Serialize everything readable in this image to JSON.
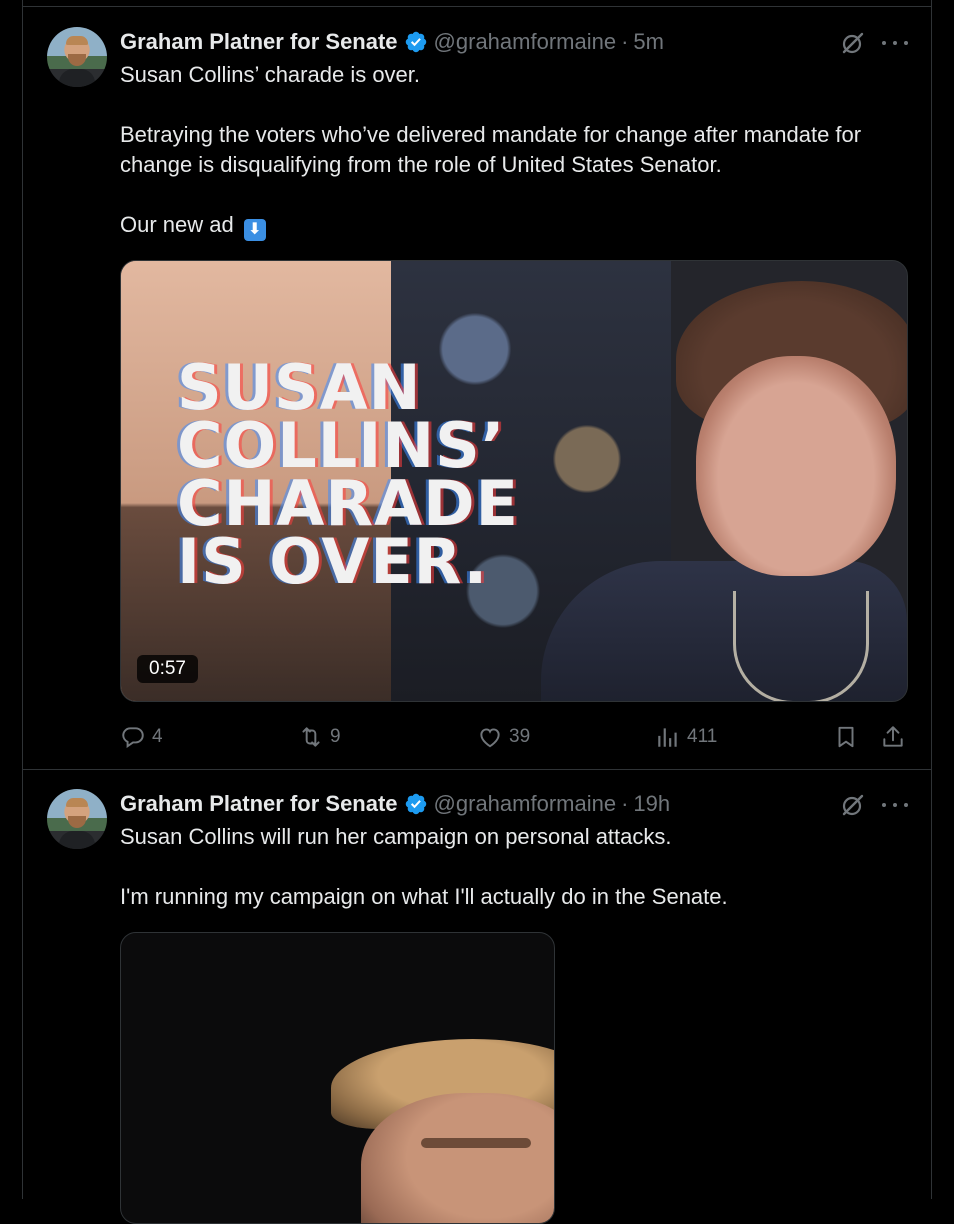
{
  "tweets": [
    {
      "author_name": "Graham Platner for Senate",
      "handle": "@grahamformaine",
      "separator": "·",
      "time": "5m",
      "text": [
        "Susan Collins’ charade is over.",
        "Betraying the voters who’ve delivered mandate for change after mandate for change is disqualifying from the role of United States Senator.",
        "Our new ad"
      ],
      "emoji": "⬇",
      "video": {
        "overlay_lines": [
          "SUSAN",
          "COLLINS’",
          "CHARADE",
          "IS OVER."
        ],
        "duration": "0:57"
      },
      "stats": {
        "replies": "4",
        "reposts": "9",
        "likes": "39",
        "views": "411"
      }
    },
    {
      "author_name": "Graham Platner for Senate",
      "handle": "@grahamformaine",
      "separator": "·",
      "time": "19h",
      "text": [
        "Susan Collins will run her campaign on personal attacks.",
        "I'm running my campaign on what I'll actually do in the Senate."
      ]
    }
  ],
  "icons": {
    "verified": "verified-badge-icon",
    "grok": "grok-icon",
    "more": "more-icon",
    "reply": "reply-icon",
    "repost": "repost-icon",
    "like": "like-icon",
    "views": "views-icon",
    "bookmark": "bookmark-icon",
    "share": "share-icon"
  },
  "colors": {
    "background": "#000000",
    "text": "#e7e9ea",
    "muted": "#71767b",
    "verified": "#1d9bf0",
    "border": "#2f3336"
  }
}
